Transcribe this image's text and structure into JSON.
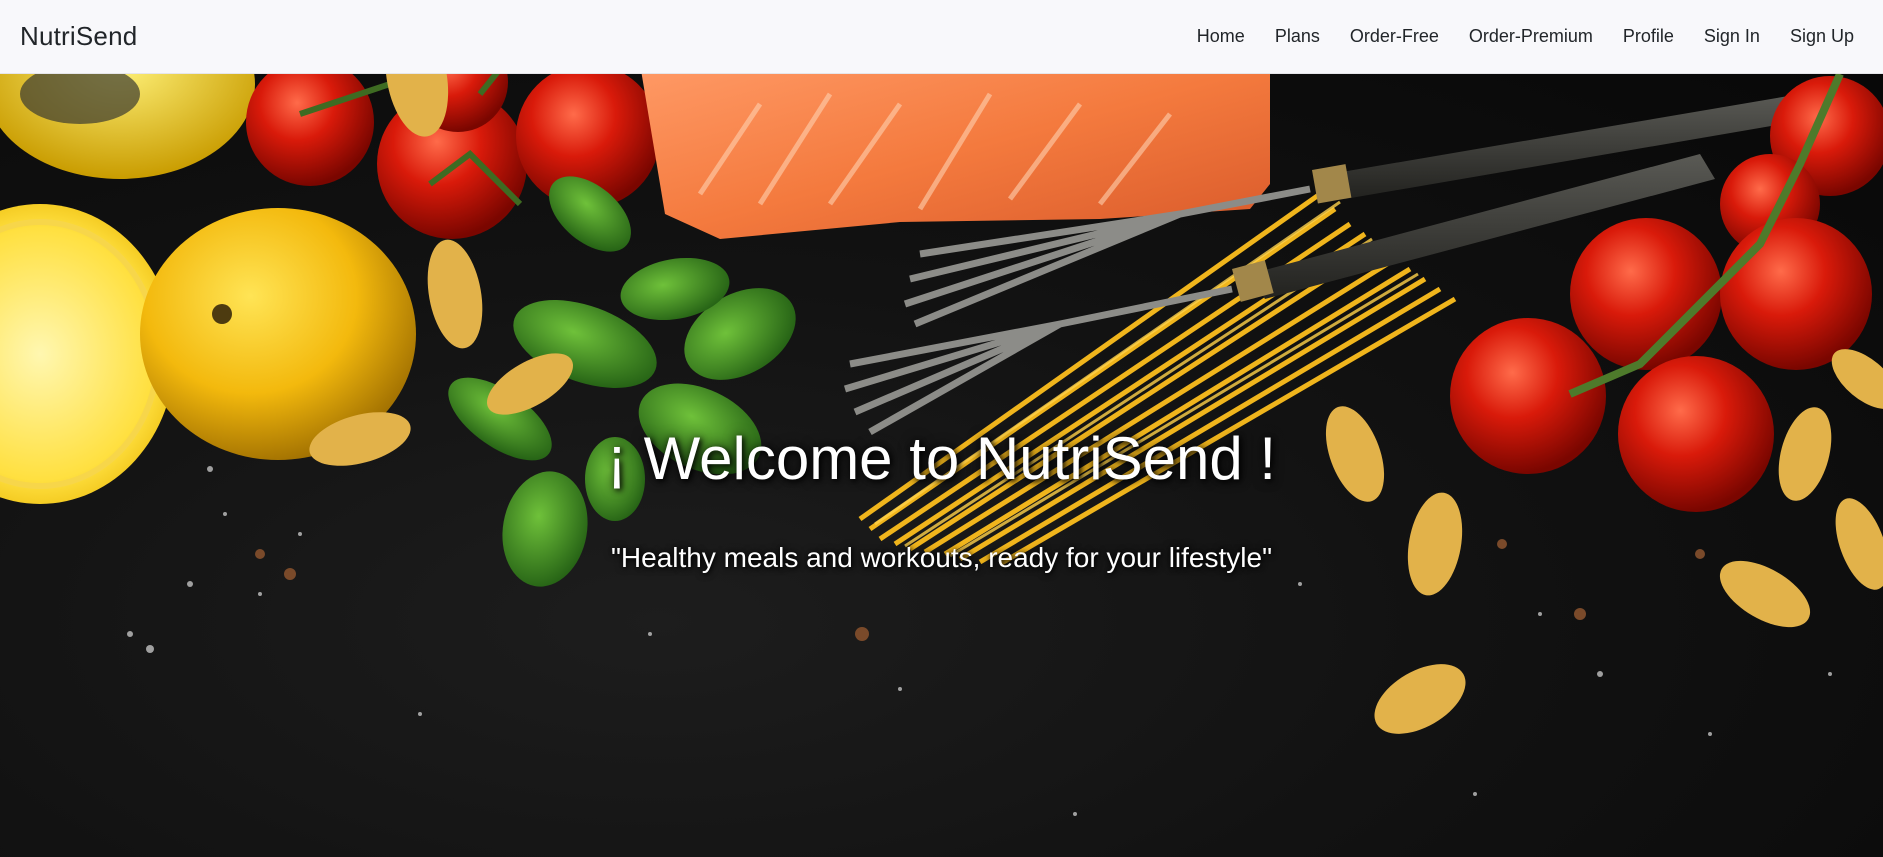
{
  "navbar": {
    "brand": "NutriSend",
    "links": [
      {
        "label": "Home"
      },
      {
        "label": "Plans"
      },
      {
        "label": "Order-Free"
      },
      {
        "label": "Order-Premium"
      },
      {
        "label": "Profile"
      },
      {
        "label": "Sign In"
      },
      {
        "label": "Sign Up"
      }
    ]
  },
  "hero": {
    "title": "¡ Welcome to NutriSend !",
    "subtitle": "\"Healthy meals and workouts, ready for your lifestyle\"",
    "background_image": "food-ingredients-dark-background"
  },
  "colors": {
    "navbar_bg": "#f8f8fb",
    "text_dark": "#212529",
    "hero_text": "#ffffff"
  }
}
